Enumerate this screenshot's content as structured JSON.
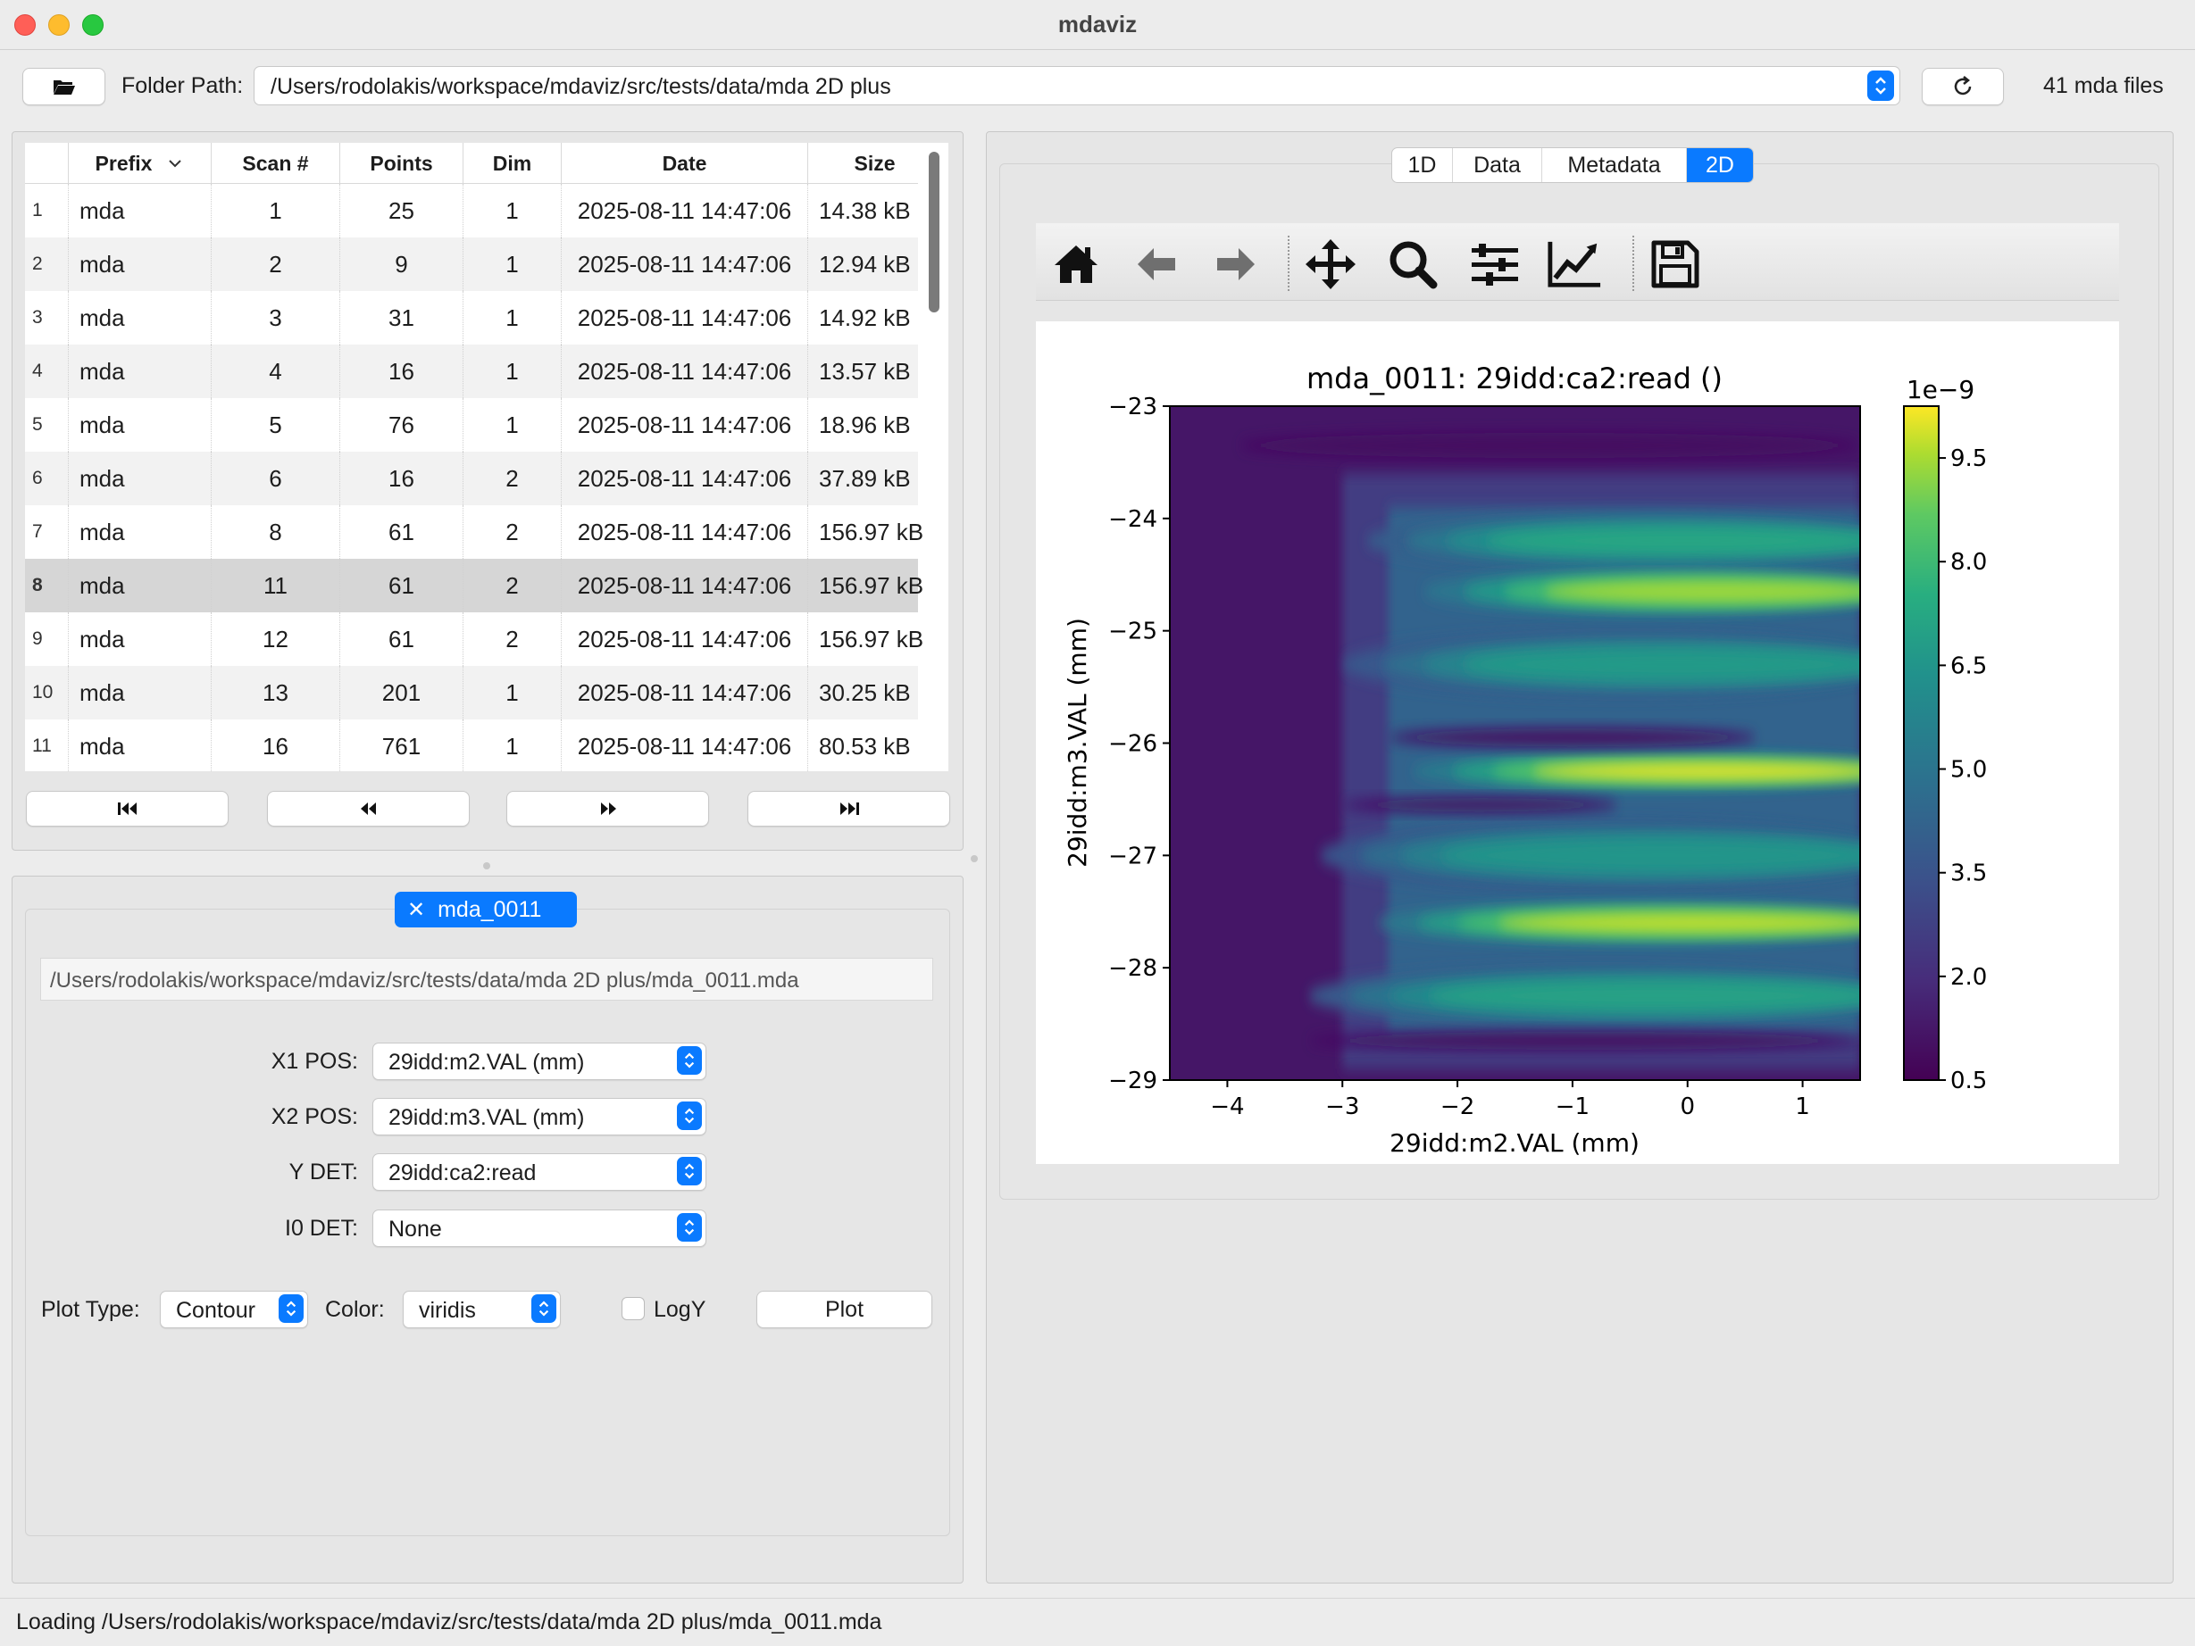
{
  "window": {
    "title": "mdaviz"
  },
  "folder_bar": {
    "folder_label": "Folder Path:",
    "folder_path": "/Users/rodolakis/workspace/mdaviz/src/tests/data/mda 2D plus",
    "files_count": "41 mda files",
    "icons": {
      "open": "folder-open-icon",
      "refresh": "refresh-icon"
    }
  },
  "table": {
    "headers": [
      "Prefix",
      "Scan #",
      "Points",
      "Dim",
      "Date",
      "Size"
    ],
    "selected_row": 8,
    "rows": [
      {
        "n": "1",
        "prefix": "mda",
        "scan": "1",
        "points": "25",
        "dim": "1",
        "date": "2025-08-11 14:47:06",
        "size": "14.38 kB"
      },
      {
        "n": "2",
        "prefix": "mda",
        "scan": "2",
        "points": "9",
        "dim": "1",
        "date": "2025-08-11 14:47:06",
        "size": "12.94 kB"
      },
      {
        "n": "3",
        "prefix": "mda",
        "scan": "3",
        "points": "31",
        "dim": "1",
        "date": "2025-08-11 14:47:06",
        "size": "14.92 kB"
      },
      {
        "n": "4",
        "prefix": "mda",
        "scan": "4",
        "points": "16",
        "dim": "1",
        "date": "2025-08-11 14:47:06",
        "size": "13.57 kB"
      },
      {
        "n": "5",
        "prefix": "mda",
        "scan": "5",
        "points": "76",
        "dim": "1",
        "date": "2025-08-11 14:47:06",
        "size": "18.96 kB"
      },
      {
        "n": "6",
        "prefix": "mda",
        "scan": "6",
        "points": "16",
        "dim": "2",
        "date": "2025-08-11 14:47:06",
        "size": "37.89 kB"
      },
      {
        "n": "7",
        "prefix": "mda",
        "scan": "8",
        "points": "61",
        "dim": "2",
        "date": "2025-08-11 14:47:06",
        "size": "156.97 kB"
      },
      {
        "n": "8",
        "prefix": "mda",
        "scan": "11",
        "points": "61",
        "dim": "2",
        "date": "2025-08-11 14:47:06",
        "size": "156.97 kB"
      },
      {
        "n": "9",
        "prefix": "mda",
        "scan": "12",
        "points": "61",
        "dim": "2",
        "date": "2025-08-11 14:47:06",
        "size": "156.97 kB"
      },
      {
        "n": "10",
        "prefix": "mda",
        "scan": "13",
        "points": "201",
        "dim": "1",
        "date": "2025-08-11 14:47:06",
        "size": "30.25 kB"
      },
      {
        "n": "11",
        "prefix": "mda",
        "scan": "16",
        "points": "761",
        "dim": "1",
        "date": "2025-08-11 14:47:06",
        "size": "80.53 kB"
      }
    ],
    "nav_icons": [
      "first-page-icon",
      "previous-page-icon",
      "next-page-icon",
      "last-page-icon"
    ]
  },
  "file_panel": {
    "tab_label": "mda_0011",
    "file_path": "/Users/rodolakis/workspace/mdaviz/src/tests/data/mda 2D plus/mda_0011.mda",
    "fields": [
      {
        "label": "X1 POS:",
        "value": "29idd:m2.VAL (mm)"
      },
      {
        "label": "X2 POS:",
        "value": "29idd:m3.VAL (mm)"
      },
      {
        "label": "Y DET:",
        "value": "29idd:ca2:read"
      },
      {
        "label": "I0 DET:",
        "value": "None"
      }
    ],
    "plot_type_label": "Plot Type:",
    "plot_type_value": "Contour",
    "color_label": "Color:",
    "color_value": "viridis",
    "logy_label": "LogY",
    "logy_checked": false,
    "plot_button": "Plot"
  },
  "viewer": {
    "tabs": [
      "1D",
      "Data",
      "Metadata",
      "2D"
    ],
    "active_tab": "2D",
    "toolbar_icons": [
      "home-icon",
      "back-arrow-icon",
      "forward-arrow-icon",
      "pan-icon",
      "zoom-icon",
      "subplots-config-icon",
      "edit-axis-icon",
      "save-icon"
    ]
  },
  "chart_data": {
    "type": "heatmap",
    "title": "mda_0011: 29idd:ca2:read ()",
    "xlabel": "29idd:m2.VAL (mm)",
    "ylabel": "29idd:m3.VAL (mm)",
    "xlim": [
      -4.5,
      1.5
    ],
    "ylim": [
      -29,
      -23
    ],
    "xticks": [
      "−4",
      "−3",
      "−2",
      "−1",
      "0",
      "1"
    ],
    "yticks": [
      "−23",
      "−24",
      "−25",
      "−26",
      "−27",
      "−28",
      "−29"
    ],
    "colormap": "viridis",
    "colorbar_multiplier": "1e−9",
    "colorbar_ticks": [
      "9.5",
      "8.0",
      "6.5",
      "5.0",
      "3.5",
      "2.0",
      "0.5"
    ],
    "colorbar_range": [
      0.5,
      10.25
    ],
    "bands": [
      {
        "y": -24.2,
        "x_from": -2.8,
        "peak": 7.2
      },
      {
        "y": -24.65,
        "x_from": -2.3,
        "peak": 9.4
      },
      {
        "y": -25.3,
        "x_from": -3.0,
        "peak": 6.7
      },
      {
        "y": -26.25,
        "x_from": -2.4,
        "peak": 10.0
      },
      {
        "y": -27.0,
        "x_from": -3.2,
        "peak": 6.5
      },
      {
        "y": -27.6,
        "x_from": -2.7,
        "peak": 9.7
      },
      {
        "y": -28.25,
        "x_from": -3.3,
        "peak": 7.0
      }
    ]
  },
  "status": {
    "message": "Loading /Users/rodolakis/workspace/mdaviz/src/tests/data/mda 2D plus/mda_0011.mda"
  }
}
